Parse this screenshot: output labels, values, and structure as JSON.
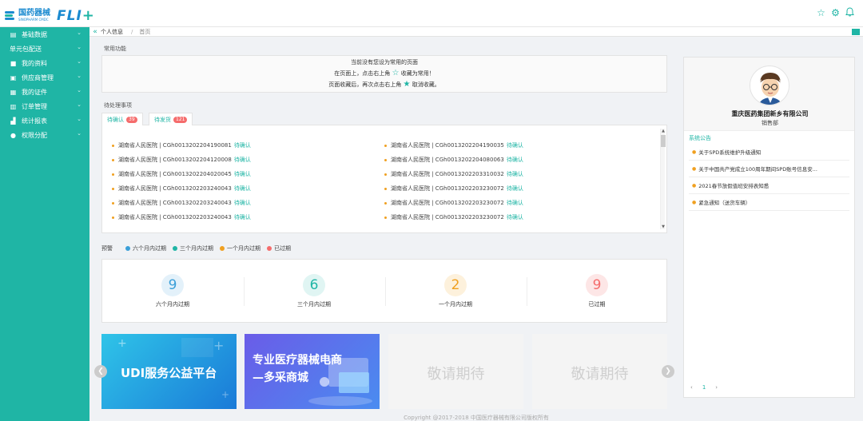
{
  "header": {
    "logo_cn": "国药器械",
    "logo_en": "SINOPHARM CMDC",
    "logo_fl": "FLI",
    "logo_plus": "+",
    "icons": [
      "star-icon",
      "gear-icon",
      "bell-icon"
    ]
  },
  "sidebar": {
    "items": [
      {
        "label": "基础数据",
        "icon": "document-icon"
      },
      {
        "label": "单元包配送",
        "icon": ""
      },
      {
        "label": "我的资料",
        "icon": "folder-icon"
      },
      {
        "label": "供应商管理",
        "icon": "contacts-icon"
      },
      {
        "label": "我的证件",
        "icon": "id-card-icon"
      },
      {
        "label": "订单管理",
        "icon": "order-icon"
      },
      {
        "label": "统计报表",
        "icon": "chart-icon"
      },
      {
        "label": "权限分配",
        "icon": "users-icon"
      }
    ]
  },
  "breadcrumb": {
    "collapse": "«",
    "current": "个人信息",
    "sep": "/",
    "home": "首页"
  },
  "common": {
    "title": "常用功能",
    "line1": "当前没有您设为常用的页面",
    "line2a": "在页面上，点击右上角",
    "line2b": "收藏为常用！",
    "line3a": "页面收藏后，再次点击右上角",
    "line3b": "取消收藏。"
  },
  "pending": {
    "title": "待处理事项",
    "tabs": [
      {
        "label": "待确认",
        "count": "39"
      },
      {
        "label": "待发货",
        "count": "121"
      }
    ],
    "left": [
      {
        "text": "湖南省人民医院 | CGh0013202204190081",
        "status": "待确认"
      },
      {
        "text": "湖南省人民医院 | CGh0013202204120008",
        "status": "待确认"
      },
      {
        "text": "湖南省人民医院 | CGh0013202204020045",
        "status": "待确认"
      },
      {
        "text": "湖南省人民医院 | CGh0013202203240043",
        "status": "待确认"
      },
      {
        "text": "湖南省人民医院 | CGh0013202203240043",
        "status": "待确认"
      },
      {
        "text": "湖南省人民医院 | CGh0013202203240043",
        "status": "待确认"
      }
    ],
    "right": [
      {
        "text": "湖南省人民医院 | CGh0013202204190035",
        "status": "待确认"
      },
      {
        "text": "湖南省人民医院 | CGh0013202204080063",
        "status": "待确认"
      },
      {
        "text": "湖南省人民医院 | CGh0013202203310032",
        "status": "待确认"
      },
      {
        "text": "湖南省人民医院 | CGh0013202203230072",
        "status": "待确认"
      },
      {
        "text": "湖南省人民医院 | CGh0013202203230072",
        "status": "待确认"
      },
      {
        "text": "湖南省人民医院 | CGh0013202203230072",
        "status": "待确认"
      }
    ]
  },
  "warning": {
    "title": "预警",
    "legend": [
      {
        "label": "六个月内过期",
        "color": "#3a9fd8"
      },
      {
        "label": "三个月内过期",
        "color": "#1fb5a5"
      },
      {
        "label": "一个月内过期",
        "color": "#f0a020"
      },
      {
        "label": "已过期",
        "color": "#f56c6c"
      }
    ],
    "stats": [
      {
        "value": "9",
        "label": "六个月内过期",
        "color": "#3a9fd8",
        "bg": "#e3f1fa"
      },
      {
        "value": "6",
        "label": "三个月内过期",
        "color": "#1fb5a5",
        "bg": "#e0f5f3"
      },
      {
        "value": "2",
        "label": "一个月内过期",
        "color": "#f0a020",
        "bg": "#fdf1dc"
      },
      {
        "value": "9",
        "label": "已过期",
        "color": "#f56c6c",
        "bg": "#fde6e6"
      }
    ]
  },
  "banners": {
    "b1": "UDI服务公益平台",
    "b2_line1": "专业医疗器械电商",
    "b2_line2": "—多采商城",
    "b3": "敬请期待",
    "b4": "敬请期待"
  },
  "footer": "Copyright @2017-2018 中国医疗器械有限公司版权所有",
  "profile": {
    "company": "重庆医药集团新乡有限公司",
    "dept": "销售部"
  },
  "notices": {
    "title": "系统公告",
    "items": [
      "关于SPD系统维护升级通知",
      "关于中国共产党成立100周年期间SPD账号信息安...",
      "2021春节放假值班安排表知悉",
      "紧急通知（送货车辆）"
    ],
    "pager": {
      "prev": "‹",
      "page": "1",
      "next": "›"
    }
  },
  "colors": {
    "accent": "#1fb5a5",
    "brand": "#1a8ad0"
  }
}
